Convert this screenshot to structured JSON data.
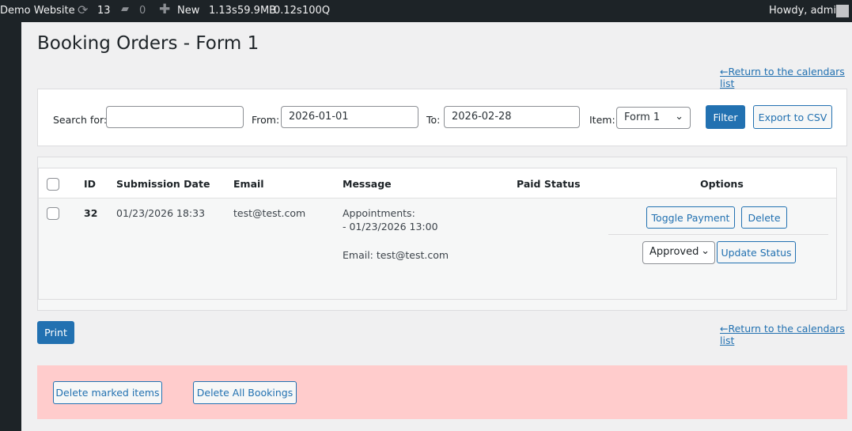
{
  "topbar": {
    "site": "Demo Website",
    "updates": "13",
    "comments": "0",
    "new": "New",
    "stats": [
      "1.13s",
      "59.9MB",
      "0.12s",
      "100Q"
    ],
    "howdy": "Howdy, admin"
  },
  "page": {
    "title": "Booking Orders - Form 1",
    "return_link": "←Return to the calendars list"
  },
  "filter": {
    "search_label": "Search for:",
    "search_value": "",
    "from_label": "From:",
    "from_value": "2026-01-01",
    "to_label": "To:",
    "to_value": "2026-02-28",
    "item_label": "Item:",
    "item_value": "Form 1",
    "filter_btn": "Filter",
    "export_btn": "Export to CSV"
  },
  "table": {
    "headers": [
      "ID",
      "Submission Date",
      "Email",
      "Message",
      "Paid Status",
      "Options"
    ],
    "rows": [
      {
        "id": "32",
        "date": "01/23/2026 18:33",
        "email": "test@test.com",
        "message": [
          "Appointments:",
          "- 01/23/2026 13:00",
          "Email: test@test.com"
        ],
        "paid": "",
        "toggle": "Toggle Payment",
        "delete": "Delete",
        "status": "Approved",
        "update": "Update Status"
      }
    ]
  },
  "print": "Print",
  "danger": {
    "delete_marked": "Delete marked items",
    "delete_all": "Delete All Bookings"
  },
  "colors": {
    "accent": "#2271b1",
    "danger_bg": "#ffcccc",
    "adminbar": "#1d2327"
  }
}
